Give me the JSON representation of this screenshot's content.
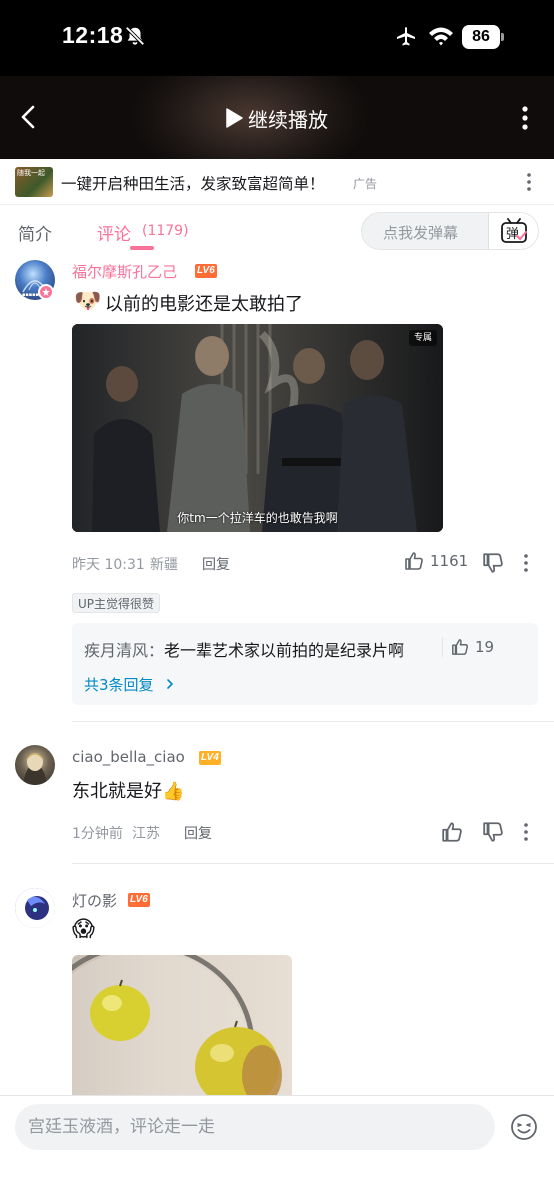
{
  "status_bar": {
    "time": "12:18",
    "battery": "86"
  },
  "video_bar": {
    "continue_label": "继续播放"
  },
  "ad": {
    "thumb_text": "随我一起",
    "text": "一键开启种田生活，发家致富超简单！",
    "tag": "广告"
  },
  "tabs": {
    "intro": "简介",
    "comments": "评论",
    "comment_count": "(1179)",
    "danmaku_placeholder": "点我发弹幕",
    "danmaku_button": "弹"
  },
  "comments": [
    {
      "username": "福尔摩斯孔乙己",
      "level": "LV6",
      "text": "以前的电影还是太敢拍了",
      "emoji": "🐶",
      "image_caption": "你tm一个拉洋车的也敢告我啊",
      "image_badge": "专属",
      "time": "昨天 10:31",
      "location": "新疆",
      "reply_label": "回复",
      "likes": "1161",
      "up_tag": "UP主觉得很赞",
      "sub_reply": {
        "user": "疾月清风",
        "text": "老一辈艺术家以前拍的是纪录片啊",
        "likes": "19",
        "more": "共3条回复"
      }
    },
    {
      "username": "ciao_bella_ciao",
      "level": "LV4",
      "text": "东北就是好👍",
      "time": "1分钟前",
      "location": "江苏",
      "reply_label": "回复"
    },
    {
      "username": "灯の影",
      "level": "LV6",
      "emoji": "😱"
    }
  ],
  "bottom": {
    "placeholder": "宫廷玉液酒，评论走一走"
  },
  "colors": {
    "accent": "#fb7299",
    "link": "#008ac5",
    "lv6": "#ff6c36",
    "lv4": "#ffb027"
  }
}
